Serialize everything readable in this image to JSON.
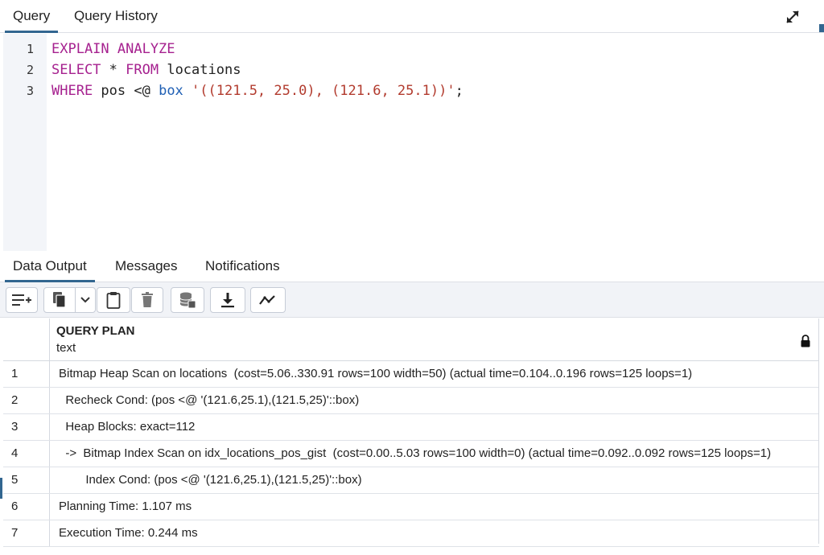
{
  "top_tabs": [
    {
      "label": "Query",
      "active": true
    },
    {
      "label": "Query History",
      "active": false
    }
  ],
  "icons": {
    "expand": "expand-arrows-icon",
    "lock": "lock-icon"
  },
  "editor": {
    "line_numbers": [
      "1",
      "2",
      "3"
    ],
    "lines": [
      [
        {
          "t": "EXPLAIN ANALYZE",
          "c": "kw"
        }
      ],
      [
        {
          "t": "SELECT",
          "c": "kw"
        },
        {
          "t": " * ",
          "c": "plain"
        },
        {
          "t": "FROM",
          "c": "kw"
        },
        {
          "t": " locations",
          "c": "plain"
        }
      ],
      [
        {
          "t": "WHERE",
          "c": "kw"
        },
        {
          "t": " pos <@ ",
          "c": "plain"
        },
        {
          "t": "box",
          "c": "fn"
        },
        {
          "t": " ",
          "c": "plain"
        },
        {
          "t": "'((121.5, 25.0), (121.6, 25.1))'",
          "c": "str"
        },
        {
          "t": ";",
          "c": "plain"
        }
      ]
    ]
  },
  "output_tabs": [
    {
      "label": "Data Output",
      "active": true
    },
    {
      "label": "Messages",
      "active": false
    },
    {
      "label": "Notifications",
      "active": false
    }
  ],
  "toolbar": {
    "buttons": [
      "add-row-icon",
      "copy-icon",
      "chevron-down-icon",
      "paste-icon",
      "delete-icon",
      "save-data-icon",
      "download-icon",
      "graph-visualiser-icon"
    ]
  },
  "grid": {
    "column": {
      "title": "QUERY PLAN",
      "type": "text"
    },
    "rows": [
      {
        "num": "1",
        "text": "Bitmap Heap Scan on locations  (cost=5.06..330.91 rows=100 width=50) (actual time=0.104..0.196 rows=125 loops=1)"
      },
      {
        "num": "2",
        "text": "  Recheck Cond: (pos <@ '(121.6,25.1),(121.5,25)'::box)"
      },
      {
        "num": "3",
        "text": "  Heap Blocks: exact=112"
      },
      {
        "num": "4",
        "text": "  ->  Bitmap Index Scan on idx_locations_pos_gist  (cost=0.00..5.03 rows=100 width=0) (actual time=0.092..0.092 rows=125 loops=1)"
      },
      {
        "num": "5",
        "text": "        Index Cond: (pos <@ '(121.6,25.1),(121.5,25)'::box)"
      },
      {
        "num": "6",
        "text": "Planning Time: 1.107 ms"
      },
      {
        "num": "7",
        "text": "Execution Time: 0.244 ms"
      }
    ]
  },
  "colors": {
    "accent": "#326690",
    "keyword": "#a6218f",
    "function": "#1f5fb4",
    "string": "#b23b2e"
  }
}
